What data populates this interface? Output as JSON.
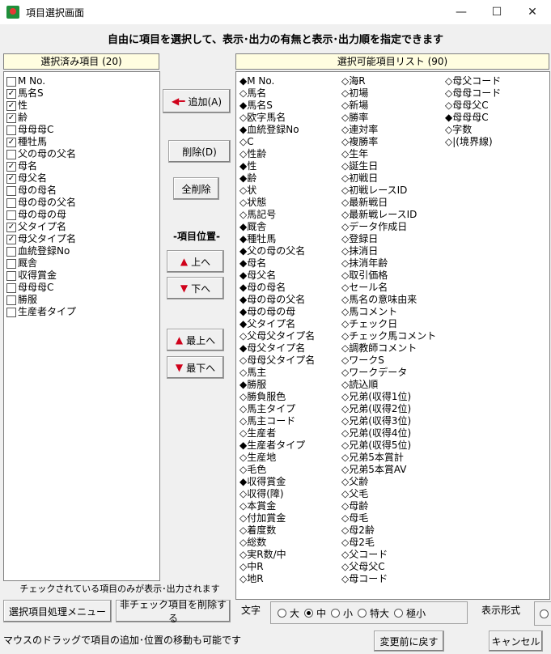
{
  "window": {
    "title": "項目選択画面",
    "minimize": "—",
    "maximize": "☐",
    "close": "✕"
  },
  "heading": "自由に項目を選択して、表示･出力の有無と表示･出力順を指定できます",
  "selected_panel": {
    "header": "選択済み項目 (20)",
    "items": [
      {
        "label": "M No.",
        "checked": false
      },
      {
        "label": "馬名S",
        "checked": true
      },
      {
        "label": "性",
        "checked": true
      },
      {
        "label": "齢",
        "checked": true
      },
      {
        "label": "母母母C",
        "checked": false
      },
      {
        "label": "種牡馬",
        "checked": true
      },
      {
        "label": "父の母の父名",
        "checked": false
      },
      {
        "label": "母名",
        "checked": true
      },
      {
        "label": "母父名",
        "checked": true
      },
      {
        "label": "母の母名",
        "checked": false
      },
      {
        "label": "母の母の父名",
        "checked": false
      },
      {
        "label": "母の母の母",
        "checked": false
      },
      {
        "label": "父タイプ名",
        "checked": true
      },
      {
        "label": "母父タイプ名",
        "checked": true
      },
      {
        "label": "血統登録No",
        "checked": false
      },
      {
        "label": "厩舎",
        "checked": false
      },
      {
        "label": "収得賞金",
        "checked": false
      },
      {
        "label": "母母母C",
        "checked": false
      },
      {
        "label": "勝服",
        "checked": false
      },
      {
        "label": "生産者タイプ",
        "checked": false
      }
    ],
    "note": "チェックされている項目のみが表示･出力されます"
  },
  "available_panel": {
    "header": "選択可能項目リスト (90)",
    "col1": [
      "◆M No.",
      "◇馬名",
      "◆馬名S",
      "◇欧字馬名",
      "◆血統登録No",
      "◇C",
      "◇性齢",
      "◆性",
      "◆齢",
      "◇状",
      "◇状態",
      "◇馬記号",
      "◆厩舎",
      "◆種牡馬",
      "◆父の母の父名",
      "◆母名",
      "◆母父名",
      "◆母の母名",
      "◆母の母の父名",
      "◆母の母の母",
      "◆父タイプ名",
      "◇父母父タイプ名",
      "◆母父タイプ名",
      "◇母母父タイプ名",
      "◇馬主",
      "◆勝服",
      "◇勝負服色",
      "◇馬主タイプ",
      "◇馬主コード",
      "◇生産者",
      "◆生産者タイプ",
      "◇生産地",
      "◇毛色",
      "◆収得賞金",
      "◇収得(障)",
      "◇本賞金",
      "◇付加賞金",
      "◇着度数",
      "◇総数",
      "◇実R数/中",
      "◇中R",
      "◇地R"
    ],
    "col2": [
      "◇海R",
      "◇初場",
      "◇新場",
      "◇勝率",
      "◇連対率",
      "◇複勝率",
      "◇生年",
      "◇誕生日",
      "◇初戦日",
      "◇初戦レースID",
      "◇最新戦日",
      "◇最新戦レースID",
      "◇データ作成日",
      "◇登録日",
      "◇抹消日",
      "◇抹消年齢",
      "◇取引価格",
      "◇セール名",
      "◇馬名の意味由来",
      "◇馬コメント",
      "◇チェック日",
      "◇チェック馬コメント",
      "◇調教師コメント",
      "◇ワークS",
      "◇ワークデータ",
      "◇読込順",
      "◇兄弟(収得1位)",
      "◇兄弟(収得2位)",
      "◇兄弟(収得3位)",
      "◇兄弟(収得4位)",
      "◇兄弟(収得5位)",
      "◇兄弟5本賞計",
      "◇兄弟5本賞AV",
      "◇父齢",
      "◇父毛",
      "◇母齢",
      "◇母毛",
      "◇母2齢",
      "◇母2毛",
      "◇父コード",
      "◇父母父C",
      "◇母コード"
    ],
    "col3": [
      "◇母父コード",
      "◇母母コード",
      "◇母母父C",
      "◆母母母C",
      "◇字数",
      "◇|(境界線)"
    ]
  },
  "buttons": {
    "add": "追加(A)",
    "delete": "削除(D)",
    "delete_all": "全削除",
    "position_label": "-項目位置-",
    "up": "上へ",
    "down": "下へ",
    "top": "最上へ",
    "bottom": "最下へ",
    "menu": "選択項目処理メニュー",
    "remove_unchecked": "非チェック項目を削除する",
    "revert": "変更前に戻す",
    "cancel": "キャンセル"
  },
  "font_size": {
    "label": "文字",
    "options": [
      "大",
      "中",
      "小",
      "特大",
      "極小"
    ],
    "selected": "中"
  },
  "display_format_label": "表示形式",
  "status_text": "マウスのドラッグで項目の追加･位置の移動も可能です"
}
